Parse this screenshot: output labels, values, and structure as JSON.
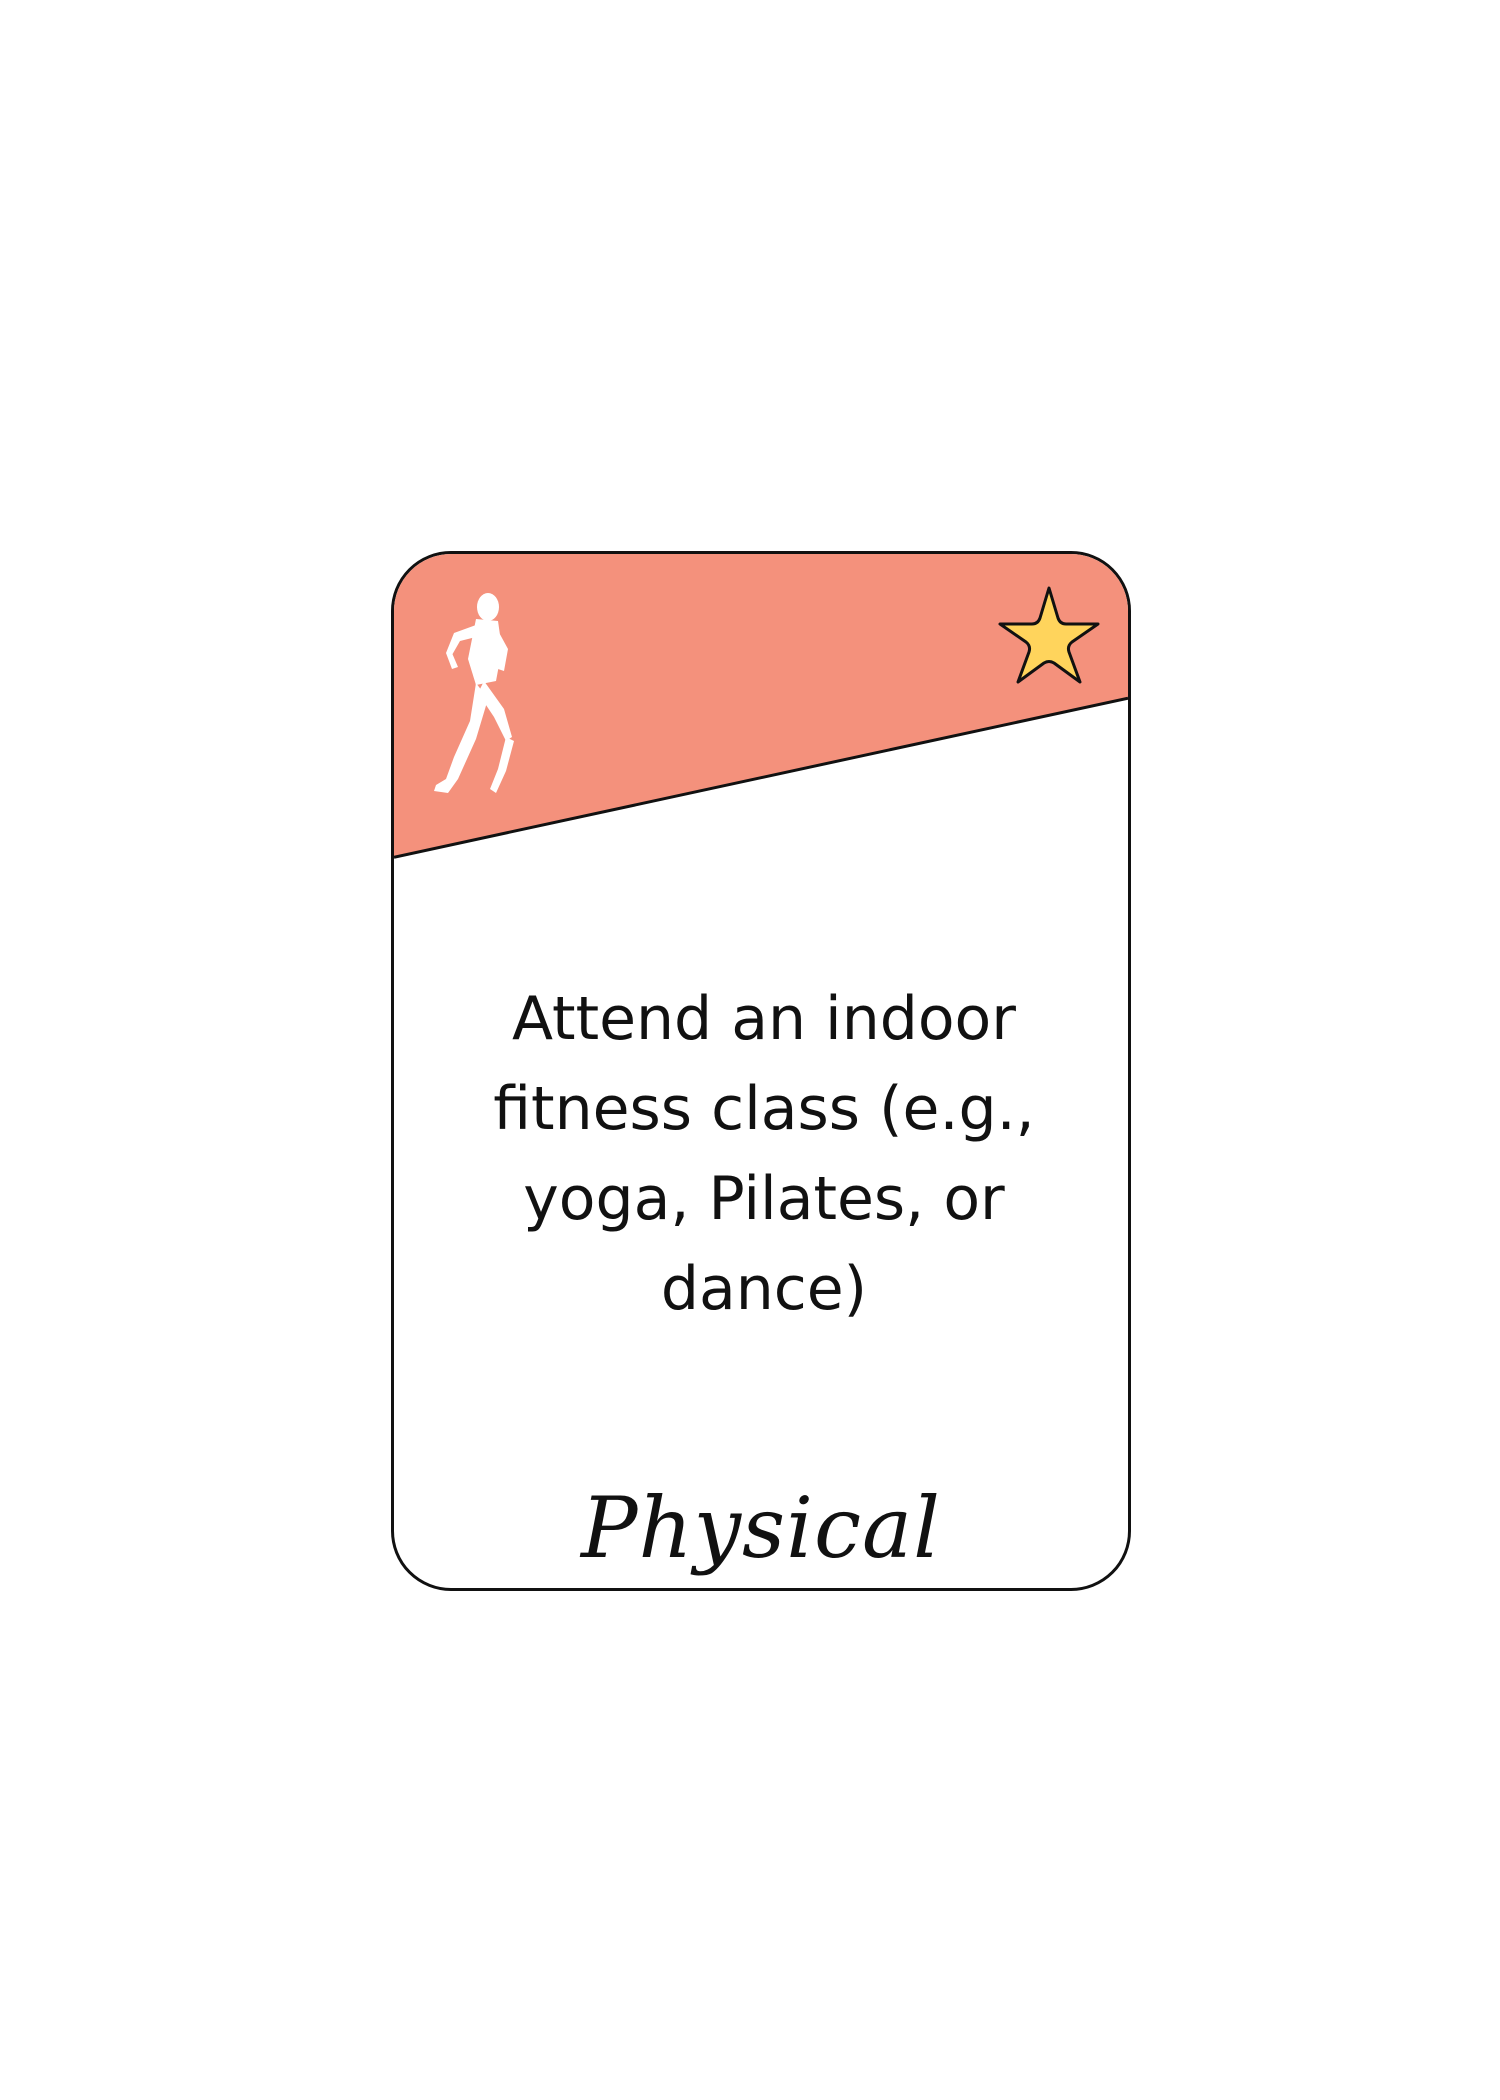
{
  "card": {
    "header_color": "#F4917C",
    "star_color": "#FFD45C",
    "text": "Attend an indoor fitness class (e.g., yoga, Pilates, or dance)",
    "category": "Physical",
    "icons": {
      "header": "runner-icon",
      "badge": "star-icon"
    }
  }
}
